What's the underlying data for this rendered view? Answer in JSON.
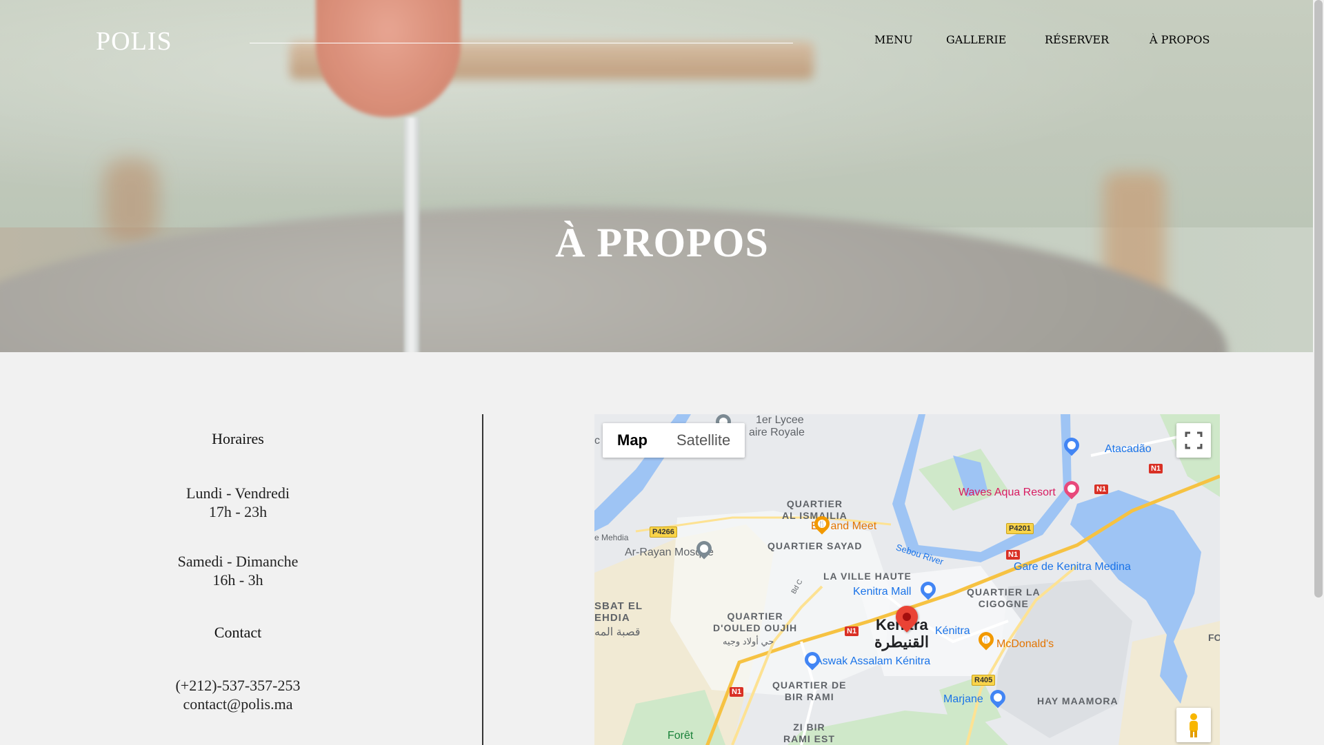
{
  "header": {
    "brand": "POLIS",
    "nav": [
      {
        "label": "MENU"
      },
      {
        "label": "GALLERIE"
      },
      {
        "label": "RÉSERVER"
      },
      {
        "label": "À PROPOS"
      }
    ],
    "hero_title": "À PROPOS"
  },
  "info": {
    "hours_title": "Horaires",
    "weekday_days": "Lundi - Vendredi",
    "weekday_hours": "17h - 23h",
    "weekend_days": "Samedi - Dimanche",
    "weekend_hours": "16h - 3h",
    "contact_title": "Contact",
    "phone": "(+212)-537-357-253",
    "email": "contact@polis.ma"
  },
  "map": {
    "type_map": "Map",
    "type_satellite": "Satellite",
    "fullscreen_icon": "fullscreen-icon",
    "pegman_icon": "pegman-icon",
    "labels": {
      "lycee_1": "1er Lycee",
      "lycee_2": "aire Royale",
      "atacadao": "Atacadão",
      "waves": "Waves Aqua Resort",
      "quartier_ismailia_1": "QUARTIER",
      "quartier_ismailia_2": "AL ISMAILIA",
      "eat_and_meet": "Eat and Meet",
      "mehdia": "e Mehdia",
      "ar_rayan": "Ar-Rayan Mosque",
      "sayad": "QUARTIER SAYAD",
      "sebou": "Sebou River",
      "gare": "Gare de Kenitra Medina",
      "ville_haute": "LA VILLE HAUTE",
      "kenitra_mall": "Kenitra Mall",
      "quartier_cigogne_1": "QUARTIER LA",
      "quartier_cigogne_2": "CIGOGNE",
      "kasbat_1": "SBAT EL",
      "kasbat_2": "EHDIA",
      "kasbat_ar": "قصبة المه",
      "ouled_1": "QUARTIER",
      "ouled_2": "D'OULED OUJIH",
      "ouled_ar": "حي أولاد وجيه",
      "kenitra": "Kenitra",
      "kenitra_ar": "القنيطرة",
      "kenitra_small": "Kénitra",
      "mcdonalds": "McDonald's",
      "aswak": "Aswak Assalam Kénitra",
      "bir_rami_1": "QUARTIER DE",
      "bir_rami_2": "BIR RAMI",
      "marjane": "Marjane",
      "maamora": "HAY MAAMORA",
      "bir_rami_est_1": "ZI BIR",
      "bir_rami_est_2": "RAMI EST",
      "foret": "Forêt",
      "bd_c": "Bd C",
      "fo": "FO",
      "c_edge": "c",
      "p4266": "P4266",
      "p4201": "P4201",
      "n1_a": "N1",
      "n1_b": "N1",
      "n1_c": "N1",
      "n1_d": "N1",
      "n1_e": "N1",
      "r405": "R405"
    }
  }
}
